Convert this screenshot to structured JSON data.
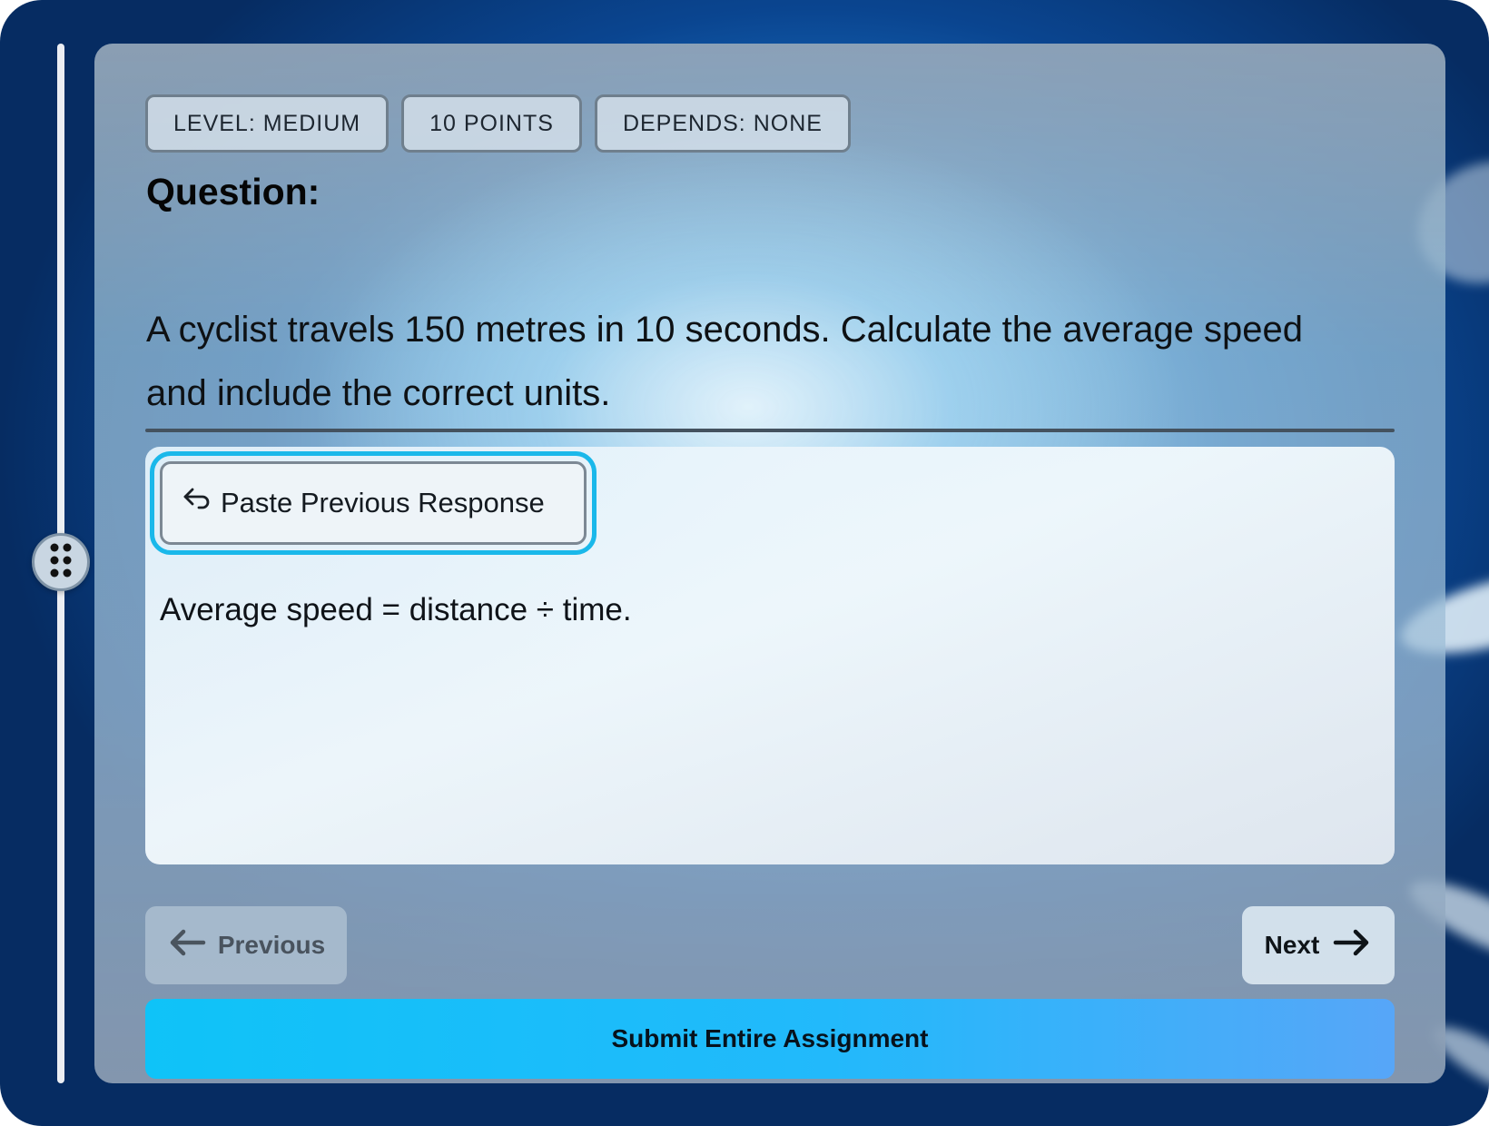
{
  "chips": {
    "level": "LEVEL:  MEDIUM",
    "points": "10  POINTS",
    "depends": "DEPENDS:  NONE"
  },
  "question": {
    "heading": "Question:",
    "text": "A cyclist travels 150 metres in 10 seconds. Calculate the average speed and include the correct units."
  },
  "answer": {
    "paste_label": "Paste Previous Response",
    "text": "Average speed = distance ÷ time."
  },
  "nav": {
    "previous_label": "Previous",
    "next_label": "Next",
    "submit_label": "Submit Entire Assignment"
  },
  "colors": {
    "accent": "#1ab8ea",
    "submit_start": "#0fc3f8",
    "submit_end": "#57a6f8"
  },
  "icons": {
    "paste": "return-arrow-icon",
    "previous": "arrow-left-icon",
    "next": "arrow-right-icon",
    "handle": "drag-handle-dots-icon"
  }
}
